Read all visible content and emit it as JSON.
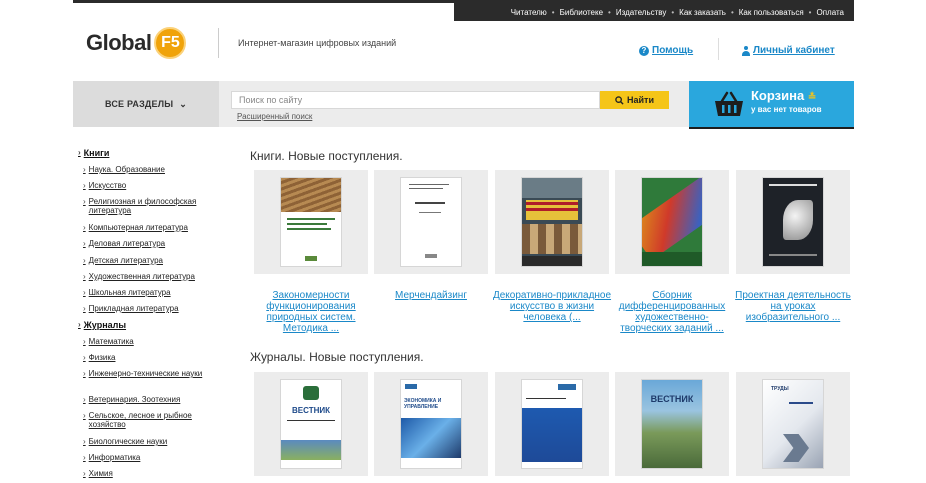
{
  "topnav": {
    "links": [
      "Читателю",
      "Библиотеке",
      "Издательству",
      "Как заказать",
      "Как пользоваться",
      "Оплата"
    ]
  },
  "header": {
    "logo_text": "Global",
    "logo_badge": "F5",
    "tagline": "Интернет-магазин цифровых изданий",
    "help_label": "Помощь",
    "cabinet_label": "Личный кабинет"
  },
  "searchbar": {
    "all_sections_label": "ВСЕ РАЗДЕЛЫ",
    "search_placeholder": "Поиск по сайту",
    "search_button": "Найти",
    "advanced_search": "Расширенный поиск",
    "cart_title": "Корзина",
    "cart_subtitle": "у вас нет товаров"
  },
  "sidebar": {
    "categories": [
      {
        "label": "Книги",
        "items": [
          "Наука. Образование",
          "Искусство",
          "Религиозная и философская литература",
          "Компьютерная литература",
          "Деловая литература",
          "Детская литература",
          "Художественная литература",
          "Школьная литература",
          "Прикладная литература"
        ]
      },
      {
        "label": "Журналы",
        "items": [
          "Математика",
          "Физика",
          "Инженерно-технические науки",
          "Ветеринария. Зоотехния",
          "Сельское, лесное и рыбное хозяйство",
          "Биологические науки",
          "Информатика",
          "Химия"
        ]
      }
    ]
  },
  "main": {
    "books_title": "Книги. Новые поступления.",
    "books": [
      {
        "caption": "Закономерности функционирования природных систем. Методика ..."
      },
      {
        "caption": "Мерчендайзинг"
      },
      {
        "caption": "Декоративно-прикладное искусство в жизни человека (..."
      },
      {
        "caption": "Сборник дифференцированных художественно-творческих заданий ..."
      },
      {
        "caption": "Проектная деятельность на уроках изобразительного ..."
      }
    ],
    "journals_title": "Журналы. Новые поступления.",
    "journals": [
      {
        "cover_text": "ВЕСТНИК"
      },
      {
        "cover_text": "ЭКОНОМИКА И УПРАВЛЕНИЕ"
      },
      {
        "cover_text": ""
      },
      {
        "cover_text": "ВЕСТНИК"
      },
      {
        "cover_text": "ТРУДЫ"
      }
    ]
  },
  "colors": {
    "accent_blue": "#1a88c8",
    "cart_blue": "#2aa7dd",
    "button_yellow": "#f5c518",
    "logo_orange": "#f0a30a"
  }
}
